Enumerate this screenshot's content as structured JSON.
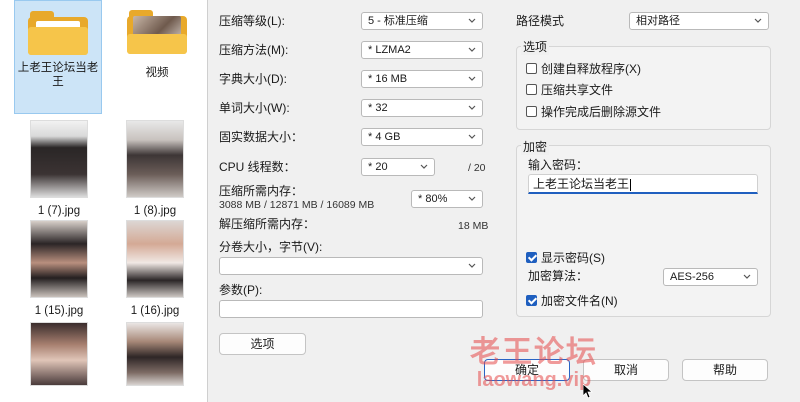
{
  "explorer": {
    "items": [
      {
        "label": "上老王论坛当老王",
        "kind": "folder"
      },
      {
        "label": "视频",
        "kind": "folder"
      },
      {
        "label": "1 (7).jpg",
        "kind": "image"
      },
      {
        "label": "1 (8).jpg",
        "kind": "image"
      },
      {
        "label": "1 (15).jpg",
        "kind": "image"
      },
      {
        "label": "1 (16).jpg",
        "kind": "image"
      },
      {
        "label": "",
        "kind": "image"
      },
      {
        "label": "",
        "kind": "image"
      }
    ]
  },
  "dialog": {
    "compression_level": {
      "label": "压缩等级(L):",
      "value": "5 - 标准压缩"
    },
    "compression_method": {
      "label": "压缩方法(M):",
      "value": "* LZMA2"
    },
    "dictionary_size": {
      "label": "字典大小(D):",
      "value": "* 16 MB"
    },
    "word_size": {
      "label": "单词大小(W):",
      "value": "* 32"
    },
    "solid_block_size": {
      "label": "固实数据大小：",
      "value": "* 4 GB"
    },
    "cpu_threads": {
      "label": "CPU 线程数：",
      "value": "* 20",
      "max": "/ 20"
    },
    "memory_compress": {
      "label": "压缩所需内存：",
      "detail": "3088 MB / 12871 MB / 16089 MB",
      "value": "* 80%"
    },
    "memory_decompress": {
      "label": "解压缩所需内存：",
      "value": "18 MB"
    },
    "split_volumes": {
      "label": "分卷大小，字节(V):",
      "value": ""
    },
    "parameters": {
      "label": "参数(P):",
      "value": ""
    },
    "options_button": "选项",
    "path_mode": {
      "label": "路径模式",
      "value": "相对路径"
    },
    "options_group": {
      "title": "选项",
      "checkboxes": [
        {
          "label": "创建自释放程序(X)",
          "checked": false
        },
        {
          "label": "压缩共享文件",
          "checked": false
        },
        {
          "label": "操作完成后删除源文件",
          "checked": false
        }
      ]
    },
    "encryption_group": {
      "title": "加密",
      "password_label": "输入密码：",
      "password_value": "上老王论坛当老王",
      "show_password": {
        "label": "显示密码(S)",
        "checked": true
      },
      "method_label": "加密算法：",
      "method_value": "AES-256",
      "encrypt_names": {
        "label": "加密文件名(N)",
        "checked": true
      }
    },
    "buttons": {
      "ok": "确定",
      "cancel": "取消",
      "help": "帮助"
    }
  },
  "watermark": {
    "text": "老王论坛",
    "url": "laowang.vip"
  },
  "colors": {
    "accent": "#1f5fbf",
    "dialog_bg": "#f0f0f0",
    "selection": "#cce4f7",
    "watermark": "#e64a4a"
  }
}
